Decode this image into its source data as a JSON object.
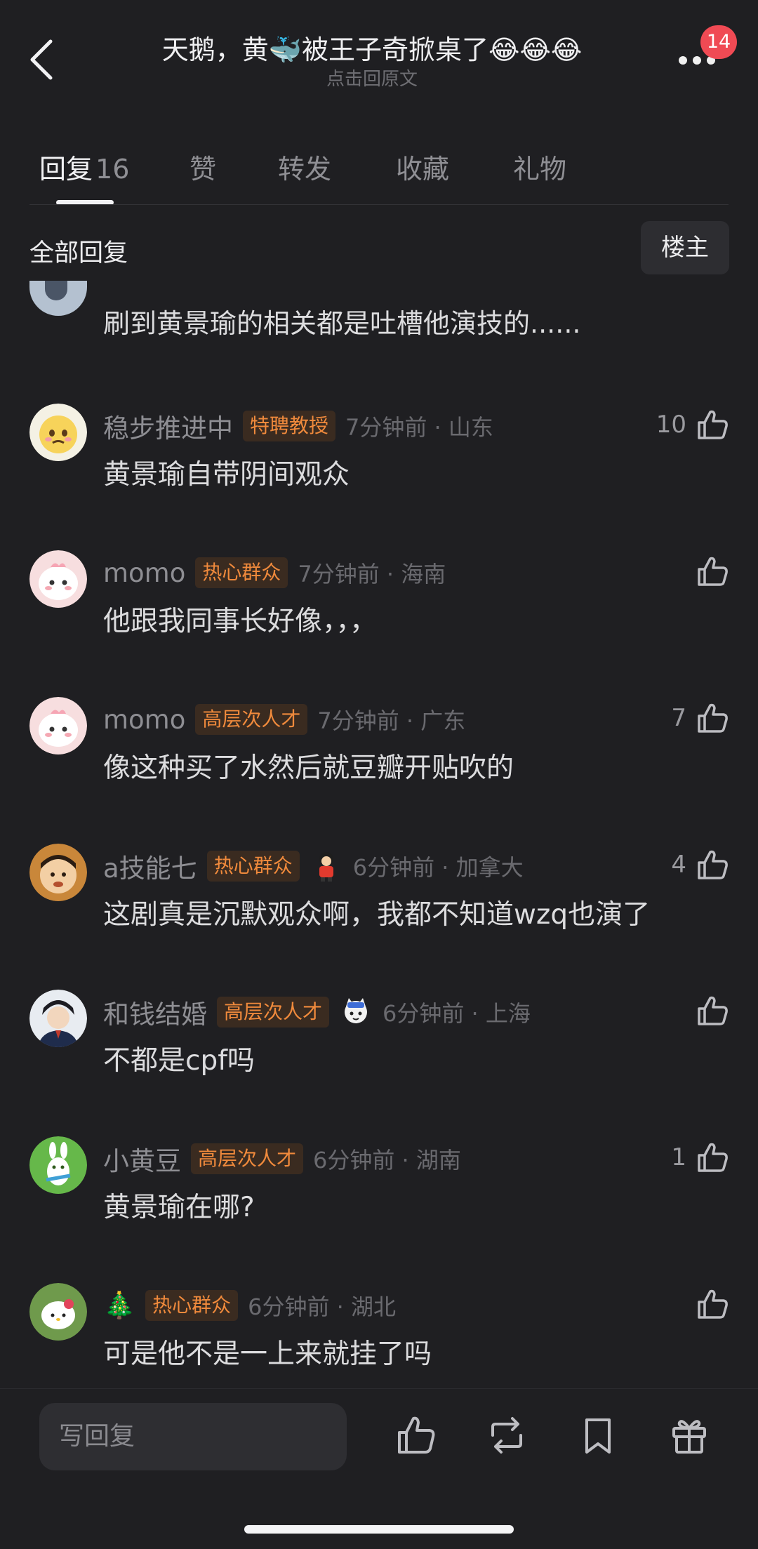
{
  "header": {
    "title": "天鹅，黄🐳被王子奇掀桌了😂😂😂",
    "subtitle": "点击回原文",
    "notification_count": "14"
  },
  "tabs": [
    {
      "label": "回复",
      "count": "16",
      "active": true
    },
    {
      "label": "赞"
    },
    {
      "label": "转发"
    },
    {
      "label": "收藏"
    },
    {
      "label": "礼物"
    }
  ],
  "filter": {
    "label": "全部回复",
    "owner_button": "楼主"
  },
  "partial_comment": {
    "text": "刷到黄景瑜的相关都是吐槽他演技的......"
  },
  "comments": [
    {
      "user": "稳步推进中",
      "tag": "特聘教授",
      "time": "7分钟前 · 山东",
      "likes": "10",
      "text": "黄景瑜自带阴间观众"
    },
    {
      "user": "momo",
      "tag": "热心群众",
      "time": "7分钟前 · 海南",
      "likes": "",
      "text": "他跟我同事长好像，，，"
    },
    {
      "user": "momo",
      "tag": "高层次人才",
      "time": "7分钟前 · 广东",
      "likes": "7",
      "text": "像这种买了水然后就豆瓣开贴吹的"
    },
    {
      "user": "a技能七",
      "tag": "热心群众",
      "time": "6分钟前 · 加拿大",
      "likes": "4",
      "text": "这剧真是沉默观众啊，我都不知道wzq也演了",
      "sticker": "boy-sticker-icon"
    },
    {
      "user": "和钱结婚",
      "tag": "高层次人才",
      "time": "6分钟前 · 上海",
      "likes": "",
      "text": "不都是cpf吗",
      "sticker": "cat-sticker-icon"
    },
    {
      "user": "小黄豆",
      "tag": "高层次人才",
      "time": "6分钟前 · 湖南",
      "likes": "1",
      "text": "黄景瑜在哪?"
    },
    {
      "user": "🎄",
      "tag": "热心群众",
      "time": "6分钟前 · 湖北",
      "likes": "",
      "text": "可是他不是一上来就挂了吗"
    }
  ],
  "bottom_bar": {
    "reply_placeholder": "写回复"
  },
  "colors": {
    "background": "#1f1f22",
    "tag_text": "#f08a3c",
    "tag_bg": "#3a2b20",
    "badge": "#f04a54"
  }
}
